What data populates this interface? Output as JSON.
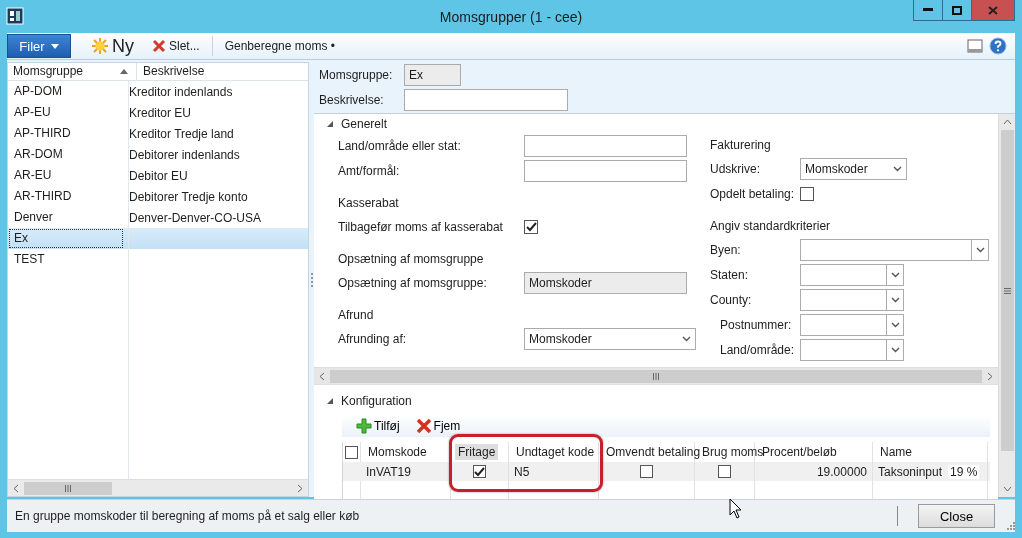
{
  "window": {
    "title": "Momsgrupper (1 - cee)"
  },
  "toolbar": {
    "items": [
      {
        "kind": "menu",
        "label": "Filer"
      },
      {
        "kind": "new",
        "label": "Ny"
      },
      {
        "kind": "delete",
        "label": "Slet..."
      },
      {
        "kind": "text",
        "label": "Genberegne moms •"
      }
    ]
  },
  "list": {
    "columns": [
      "Momsgruppe",
      "Beskrivelse"
    ],
    "rows": [
      {
        "code": "AP-DOM",
        "description": "Kreditor indenlands",
        "selected": false
      },
      {
        "code": "AP-EU",
        "description": "Kreditor EU",
        "selected": false
      },
      {
        "code": "AP-THIRD",
        "description": "Kreditor Tredje land",
        "selected": false
      },
      {
        "code": "AR-DOM",
        "description": "Debitorer indenlands",
        "selected": false
      },
      {
        "code": "AR-EU",
        "description": "Debitor EU",
        "selected": false
      },
      {
        "code": "AR-THIRD",
        "description": "Debitorer Tredje konto",
        "selected": false
      },
      {
        "code": "Denver",
        "description": "Denver-Denver-CO-USA",
        "selected": false
      },
      {
        "code": "Ex",
        "selected": true
      },
      {
        "code": "TEST",
        "selected": false
      }
    ]
  },
  "header": {
    "fields": [
      {
        "label": "Momsgruppe:",
        "value": "Ex",
        "kind": "readonly"
      },
      {
        "label": "Beskrivelse:",
        "kind": "text"
      }
    ]
  },
  "generelt": {
    "title": "Generelt",
    "expanded": true,
    "left_groups": [
      {
        "items": [
          {
            "kind": "text",
            "label": "Land/område eller stat:"
          },
          {
            "kind": "text",
            "label": "Amt/formål:"
          }
        ]
      },
      {
        "heading": "Kasserabat",
        "items": [
          {
            "kind": "checkbox",
            "label": "Tilbagefør moms af kasserabat",
            "checked": true
          }
        ]
      },
      {
        "heading": "Opsætning af momsgruppe",
        "items": [
          {
            "kind": "readonly",
            "label": "Opsætning af momsgruppe:",
            "value": "Momskoder"
          }
        ]
      },
      {
        "heading": "Afrund",
        "items": [
          {
            "kind": "select",
            "label": "Afrunding af:",
            "value": "Momskoder"
          }
        ]
      }
    ],
    "right_groups": [
      {
        "heading": "Fakturering",
        "items": [
          {
            "kind": "select-narrow",
            "label": "Udskrive:",
            "value": "Momskoder"
          },
          {
            "kind": "checkbox-short",
            "label": "Opdelt betaling:",
            "checked": false
          }
        ]
      },
      {
        "heading": "Angiv standardkriterier",
        "items": [
          {
            "kind": "combo-wide",
            "label": "Byen:",
            "indented": false
          },
          {
            "kind": "combo",
            "label": "Staten:",
            "indented": false
          },
          {
            "kind": "combo",
            "label": "County:",
            "indented": false
          },
          {
            "kind": "combo",
            "label": "Postnummer:",
            "indented": true
          },
          {
            "kind": "combo",
            "label": "Land/område:",
            "indented": true
          }
        ]
      }
    ]
  },
  "konfiguration": {
    "title": "Konfiguration",
    "expanded": true,
    "buttons": [
      {
        "kind": "add",
        "label": "Tilføj"
      },
      {
        "kind": "remove",
        "label": "Fjem"
      }
    ],
    "select_all": false,
    "columns": [
      "Momskode",
      "Fritage",
      "Undtaget kode",
      "Omvendt betaling",
      "Brug moms",
      "Procent/beløb",
      "Name"
    ],
    "rows": [
      {
        "momskode": "InVAT19",
        "fritage": true,
        "undtaget_kode": "N5",
        "omvendt_betaling": false,
        "brug_moms": false,
        "procent": "19.00000",
        "name": "Taksoninput",
        "name_rate": "19 %"
      }
    ]
  },
  "status_bar": {
    "text": "En gruppe momskoder til beregning af moms på et salg eller køb",
    "button": "Close"
  }
}
